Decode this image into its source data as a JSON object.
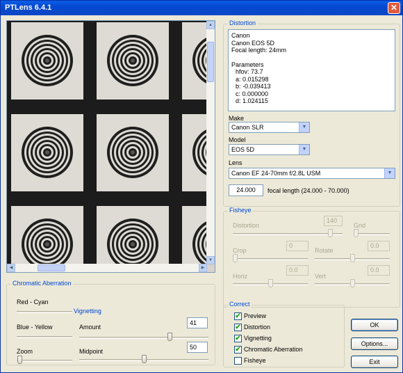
{
  "window": {
    "title": "PTLens 6.4.1",
    "close_icon": "close-icon"
  },
  "distortion": {
    "group_label": "Distortion",
    "info": {
      "maker": "Canon",
      "camera": "Canon EOS 5D",
      "focal": "Focal length: 24mm",
      "params_header": "Parameters",
      "hfov": "hfov: 73.7",
      "a": "a:   0.015298",
      "b": "b:   -0.039413",
      "c": "c:   0.000000",
      "d": "d:   1.024115"
    },
    "make_label": "Make",
    "make_value": "Canon SLR",
    "model_label": "Model",
    "model_value": "EOS 5D",
    "lens_label": "Lens",
    "lens_value": "Canon EF 24-70mm f/2.8L USM",
    "focal_value": "24.000",
    "focal_label": "focal length (24.000 - 70.000)"
  },
  "fisheye": {
    "group_label": "Fisheye",
    "distortion_label": "Distortion",
    "distortion_value": "140",
    "grid_label": "Grid",
    "crop_label": "Crop",
    "crop_value": "0",
    "rotate_label": "Rotate",
    "rotate_value": "0.0",
    "horiz_label": "Horiz",
    "horiz_value": "0.0",
    "vert_label": "Vert",
    "vert_value": "0.0"
  },
  "chromatic": {
    "group_label": "Chromatic Aberration",
    "red_cyan_label": "Red - Cyan",
    "blue_yellow_label": "Blue - Yellow",
    "zoom_label": "Zoom"
  },
  "vignetting": {
    "group_label": "Vignetting",
    "amount_label": "Amount",
    "amount_value": "41",
    "midpoint_label": "Midpoint",
    "midpoint_value": "50"
  },
  "correct": {
    "group_label": "Correct",
    "items": [
      {
        "label": "Preview",
        "checked": "✔"
      },
      {
        "label": "Distortion",
        "checked": "✔"
      },
      {
        "label": "Vignetting",
        "checked": "✔"
      },
      {
        "label": "Chromatic Aberration",
        "checked": "✔"
      },
      {
        "label": "Fisheye",
        "checked": ""
      }
    ]
  },
  "buttons": {
    "ok": "OK",
    "options": "Options...",
    "exit": "Exit"
  },
  "icons": {
    "dropdown": "▼",
    "up": "▲",
    "down": "▼",
    "left": "◀",
    "right": "▶"
  }
}
